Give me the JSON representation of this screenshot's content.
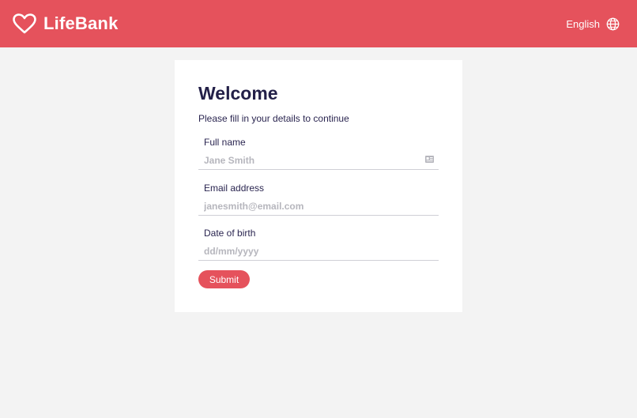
{
  "header": {
    "brand_name": "LifeBank",
    "logo_icon": "heart-icon",
    "language_label": "English",
    "language_icon": "globe-icon",
    "background_color": "#e5525c"
  },
  "form": {
    "title": "Welcome",
    "subtitle": "Please fill in your details to continue",
    "fields": [
      {
        "label": "Full name",
        "placeholder": "Jane Smith",
        "value": "",
        "icon": "id-card-icon"
      },
      {
        "label": "Email address",
        "placeholder": "janesmith@email.com",
        "value": ""
      },
      {
        "label": "Date of birth",
        "placeholder": "dd/mm/yyyy",
        "value": ""
      }
    ],
    "submit_label": "Submit",
    "accent_color": "#e5525c"
  }
}
